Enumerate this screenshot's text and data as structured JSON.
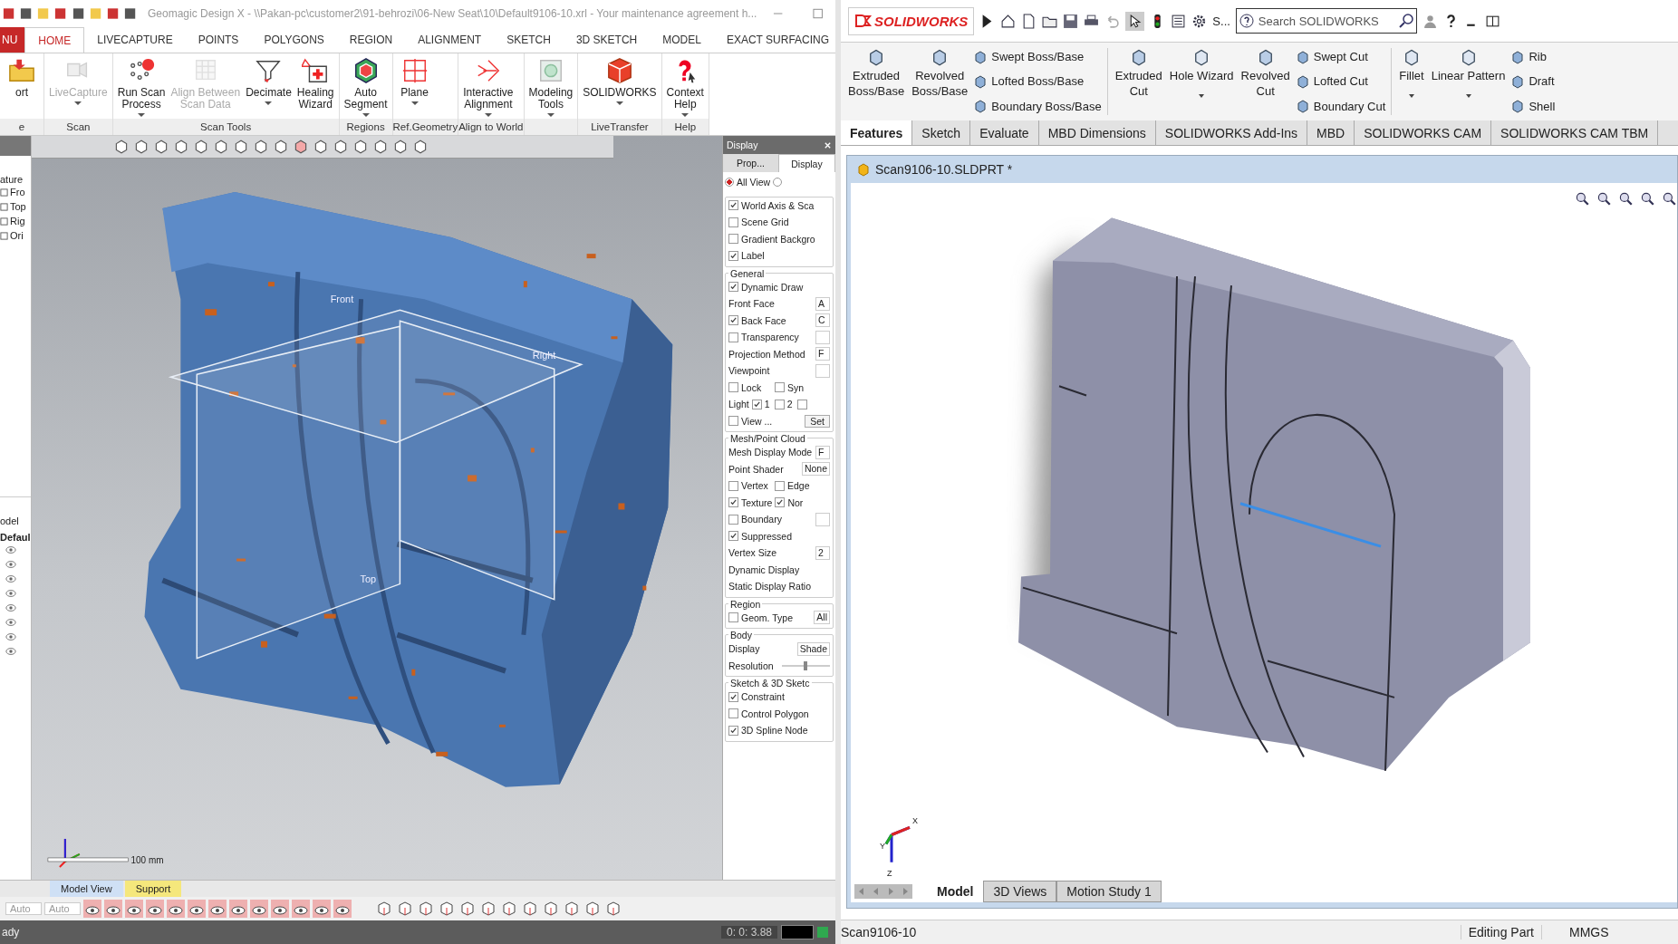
{
  "left_window": {
    "title": "Geomagic Design X - \\\\Pakan-pc\\customer2\\91-behrozi\\06-New Seat\\10\\Default9106-10.xrl - Your maintenance agreement h...",
    "menu_label": "NU",
    "tabs": [
      {
        "label": "HOME",
        "selected": true
      },
      {
        "label": "LIVECAPTURE",
        "selected": false
      },
      {
        "label": "POINTS",
        "selected": false
      },
      {
        "label": "POLYGONS",
        "selected": false
      },
      {
        "label": "REGION",
        "selected": false
      },
      {
        "label": "ALIGNMENT",
        "selected": false
      },
      {
        "label": "SKETCH",
        "selected": false
      },
      {
        "label": "3D SKETCH",
        "selected": false
      },
      {
        "label": "MODEL",
        "selected": false
      },
      {
        "label": "EXACT SURFACING",
        "selected": false
      }
    ],
    "ribbon_groups": [
      {
        "label": "e",
        "buttons": [
          {
            "label": "ort",
            "disabled": false,
            "dropdown": false
          }
        ]
      },
      {
        "label": "Scan",
        "buttons": [
          {
            "label": "LiveCapture",
            "disabled": true,
            "dropdown": true
          }
        ]
      },
      {
        "label": "Scan Tools",
        "buttons": [
          {
            "label": "Run Scan\nProcess",
            "disabled": false,
            "dropdown": true
          },
          {
            "label": "Align Between\nScan Data",
            "disabled": true,
            "dropdown": false
          },
          {
            "label": "Decimate",
            "disabled": false,
            "dropdown": true
          },
          {
            "label": "Healing\nWizard",
            "disabled": false,
            "dropdown": false
          }
        ]
      },
      {
        "label": "Regions",
        "buttons": [
          {
            "label": "Auto\nSegment",
            "disabled": false,
            "dropdown": true
          }
        ]
      },
      {
        "label": "Ref.Geometry",
        "buttons": [
          {
            "label": "Plane",
            "disabled": false,
            "dropdown": true
          }
        ]
      },
      {
        "label": "Align to World",
        "buttons": [
          {
            "label": "Interactive\nAlignment",
            "disabled": false,
            "dropdown": true
          }
        ]
      },
      {
        "buttons": [
          {
            "label": "Modeling\nTools",
            "disabled": false,
            "dropdown": true
          }
        ]
      },
      {
        "label": "LiveTransfer",
        "buttons": [
          {
            "label": "SOLIDWORKS",
            "disabled": false,
            "dropdown": true
          }
        ]
      },
      {
        "label": "Help",
        "buttons": [
          {
            "label": "Context\nHelp",
            "disabled": false,
            "dropdown": true
          }
        ]
      }
    ],
    "tree": {
      "header": "ature",
      "items": [
        "Fro",
        "Top",
        "Rig",
        "Ori"
      ],
      "lower_header": "odel",
      "lower_title": "Defaul"
    },
    "viewport": {
      "plane_labels": [
        "Front",
        "Right",
        "Top"
      ],
      "scale": "100 mm"
    },
    "display_panel": {
      "title": "Display",
      "tabs": [
        {
          "label": "Prop...",
          "selected": false
        },
        {
          "label": "Display",
          "selected": true
        }
      ],
      "radios": [
        {
          "label": "All View",
          "selected": true
        },
        {
          "selected": false
        }
      ],
      "sections": [
        {
          "rows": [
            [
              {
                "kind": "check",
                "label": "World Axis & Sca",
                "checked": true
              }
            ],
            [
              {
                "kind": "check",
                "label": "Scene Grid",
                "checked": false
              }
            ],
            [
              {
                "kind": "check",
                "label": "Gradient Backgro",
                "checked": false
              }
            ],
            [
              {
                "kind": "check",
                "label": "Label",
                "checked": true
              }
            ]
          ]
        },
        {
          "title": "General",
          "rows": [
            [
              {
                "kind": "check",
                "label": "Dynamic Draw",
                "checked": true
              }
            ],
            [
              {
                "kind": "text",
                "label": "Front Face"
              },
              {
                "kind": "field",
                "value": "A"
              }
            ],
            [
              {
                "kind": "check",
                "label": "Back Face",
                "checked": true
              },
              {
                "kind": "field",
                "value": "C"
              }
            ],
            [
              {
                "kind": "check",
                "label": "Transparency",
                "checked": false
              },
              {
                "kind": "field"
              }
            ],
            [
              {
                "kind": "text",
                "label": "Projection Method"
              },
              {
                "kind": "field",
                "value": "F"
              }
            ],
            [
              {
                "kind": "text",
                "label": "Viewpoint"
              },
              {
                "kind": "field"
              }
            ],
            [
              {
                "kind": "check",
                "label": "Lock",
                "checked": false
              },
              {
                "kind": "blank"
              },
              {
                "kind": "check",
                "label": "Syn",
                "checked": false
              }
            ],
            [
              {
                "kind": "group",
                "label": "Light",
                "items": [
                  {
                    "label": "1",
                    "checked": true
                  },
                  {
                    "label": "2",
                    "checked": false
                  },
                  {
                    "checked": false
                  }
                ]
              }
            ],
            [
              {
                "kind": "check",
                "label": "View ...",
                "checked": false
              },
              {
                "kind": "button",
                "label": "Set"
              }
            ]
          ]
        },
        {
          "title": "Mesh/Point Cloud",
          "rows": [
            [
              {
                "kind": "text",
                "label": "Mesh Display Mode"
              },
              {
                "kind": "field",
                "value": "F"
              }
            ],
            [
              {
                "kind": "text",
                "label": "Point Shader"
              },
              {
                "kind": "field",
                "value": "None"
              }
            ],
            [
              {
                "kind": "check",
                "label": "Vertex",
                "checked": false
              },
              {
                "kind": "check",
                "label": "Edge",
                "checked": false
              }
            ],
            [
              {
                "kind": "check",
                "label": "Texture",
                "checked": true
              },
              {
                "kind": "check",
                "label": "Nor",
                "checked": true
              }
            ],
            [
              {
                "kind": "check",
                "label": "Boundary",
                "checked": false
              },
              {
                "kind": "field"
              }
            ],
            [
              {
                "kind": "check",
                "label": "Suppressed",
                "checked": true
              }
            ],
            [
              {
                "kind": "text",
                "label": "Vertex Size"
              },
              {
                "kind": "field",
                "value": "2"
              }
            ],
            [
              {
                "kind": "text",
                "label": "Dynamic Display"
              }
            ],
            [
              {
                "kind": "text",
                "label": "Static Display Ratio"
              }
            ]
          ]
        },
        {
          "title": "Region",
          "rows": [
            [
              {
                "kind": "check",
                "label": "Geom. Type",
                "checked": false
              },
              {
                "kind": "field",
                "value": "All"
              }
            ]
          ]
        },
        {
          "title": "Body",
          "rows": [
            [
              {
                "kind": "text",
                "label": "Display"
              },
              {
                "kind": "field",
                "value": "Shade"
              }
            ],
            [
              {
                "kind": "text",
                "label": "Resolution"
              },
              {
                "kind": "slider",
                "level": 0.5
              }
            ]
          ]
        },
        {
          "title": "Sketch & 3D Sketc",
          "rows": [
            [
              {
                "kind": "check",
                "label": "Constraint",
                "checked": true
              }
            ],
            [
              {
                "kind": "check",
                "label": "Control Polygon",
                "checked": false
              }
            ],
            [
              {
                "kind": "check",
                "label": "3D Spline Node",
                "checked": true
              }
            ]
          ]
        }
      ]
    },
    "view_tabs": [
      {
        "label": "Model View",
        "color": "#cfe0f5"
      },
      {
        "label": "Support",
        "color": "#f5e77c"
      }
    ],
    "combos": [
      "Auto",
      "Auto"
    ],
    "status_bar": {
      "message": "ady",
      "time": "0: 0: 3.88"
    }
  },
  "right_window": {
    "logo": "SOLIDWORKS",
    "more_label": "S...",
    "search": {
      "placeholder": "Search SOLIDWORKS"
    },
    "commands": [
      {
        "kind": "large",
        "label": "Extruded\nBoss/Base"
      },
      {
        "kind": "large",
        "label": "Revolved\nBoss/Base"
      },
      {
        "kind": "stack",
        "items": [
          "Swept Boss/Base",
          "Lofted Boss/Base",
          "Boundary Boss/Base"
        ]
      },
      {
        "kind": "large",
        "label": "Extruded\nCut"
      },
      {
        "kind": "menu",
        "label": "Hole Wizard"
      },
      {
        "kind": "large",
        "label": "Revolved\nCut"
      },
      {
        "kind": "stack",
        "items": [
          "Swept Cut",
          "Lofted Cut",
          "Boundary Cut"
        ]
      },
      {
        "kind": "menu",
        "label": "Fillet"
      },
      {
        "kind": "menu",
        "label": "Linear Pattern"
      },
      {
        "kind": "stack",
        "items": [
          "Rib",
          "Draft",
          "Shell"
        ]
      }
    ],
    "tabs": [
      {
        "label": "Features",
        "selected": true
      },
      {
        "label": "Sketch",
        "selected": false
      },
      {
        "label": "Evaluate",
        "selected": false
      },
      {
        "label": "MBD Dimensions",
        "selected": false
      },
      {
        "label": "SOLIDWORKS Add-Ins",
        "selected": false
      },
      {
        "label": "MBD",
        "selected": false
      },
      {
        "label": "SOLIDWORKS CAM",
        "selected": false
      },
      {
        "label": "SOLIDWORKS CAM TBM",
        "selected": false
      }
    ],
    "document": {
      "title": "Scan9106-10.SLDPRT *",
      "triad_labels": [
        "X",
        "Y",
        "Z"
      ],
      "tabs": [
        {
          "label": "Model",
          "selected": true
        },
        {
          "label": "3D Views",
          "selected": false
        },
        {
          "label": "Motion Study 1",
          "selected": false
        }
      ]
    },
    "status_bar": {
      "name": "Scan9106-10",
      "mode": "Editing Part",
      "units": "MMGS"
    }
  }
}
